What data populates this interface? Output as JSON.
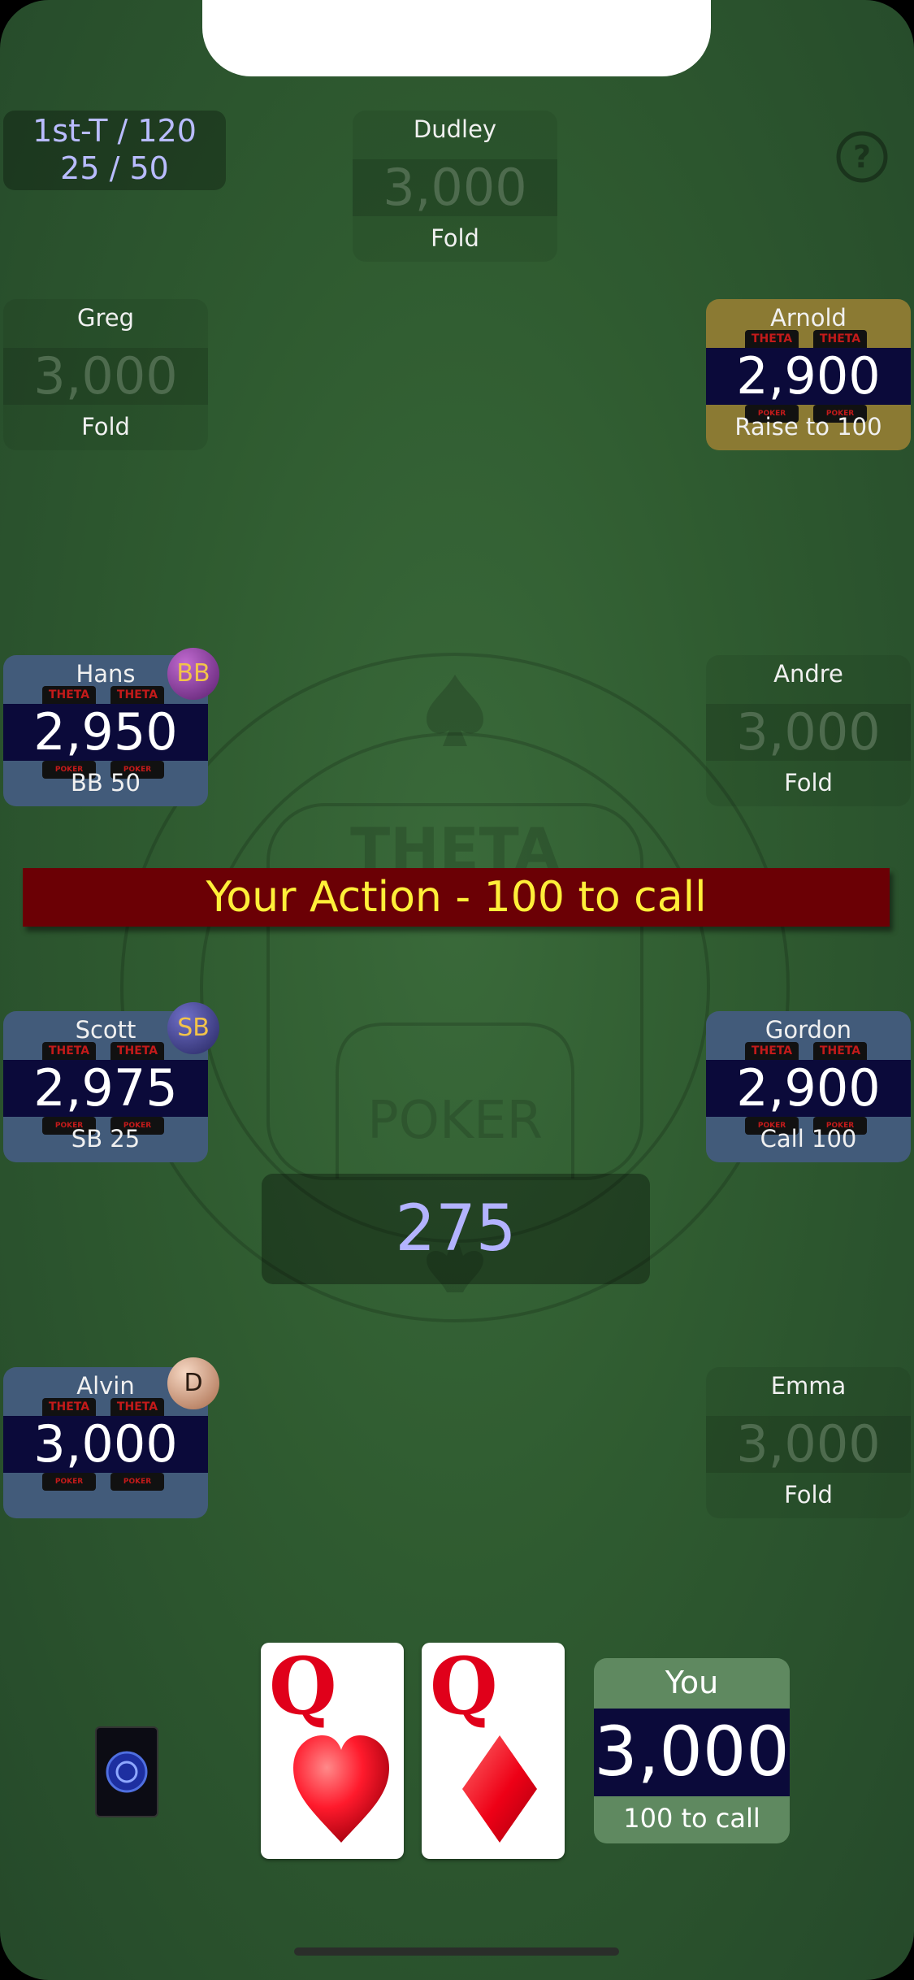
{
  "blind_info": {
    "line1": "1st-T / 120",
    "line2": "25 / 50"
  },
  "help_icon": "help-circle-icon",
  "chip_text": {
    "top": "THETA",
    "bottom": "POKER"
  },
  "table_logo": {
    "top": "THETA",
    "bottom": "POKER"
  },
  "players": [
    {
      "name": "Dudley",
      "stack": "3,000",
      "action": "Fold"
    },
    {
      "name": "Greg",
      "stack": "3,000",
      "action": "Fold"
    },
    {
      "name": "Arnold",
      "stack": "2,900",
      "action": "Raise to 100"
    },
    {
      "name": "Hans",
      "stack": "2,950",
      "action": "BB 50",
      "marker": "BB"
    },
    {
      "name": "Andre",
      "stack": "3,000",
      "action": "Fold"
    },
    {
      "name": "Scott",
      "stack": "2,975",
      "action": "SB 25",
      "marker": "SB"
    },
    {
      "name": "Gordon",
      "stack": "2,900",
      "action": "Call 100"
    },
    {
      "name": "Alvin",
      "stack": "3,000",
      "action": "",
      "marker": "D"
    },
    {
      "name": "Emma",
      "stack": "3,000",
      "action": "Fold"
    }
  ],
  "banner": "Your Action - 100 to call",
  "pot": "275",
  "hole_cards": [
    {
      "rank": "Q",
      "suit": "hearts"
    },
    {
      "rank": "Q",
      "suit": "diamonds"
    }
  ],
  "you": {
    "name": "You",
    "stack": "3,000",
    "action": "100 to call"
  },
  "colors": {
    "felt": "#2f5b30",
    "banner_bg": "#6b0005",
    "banner_text": "#ffef39",
    "pot_text": "#b3b3ff",
    "card_red": "#e0001a"
  }
}
